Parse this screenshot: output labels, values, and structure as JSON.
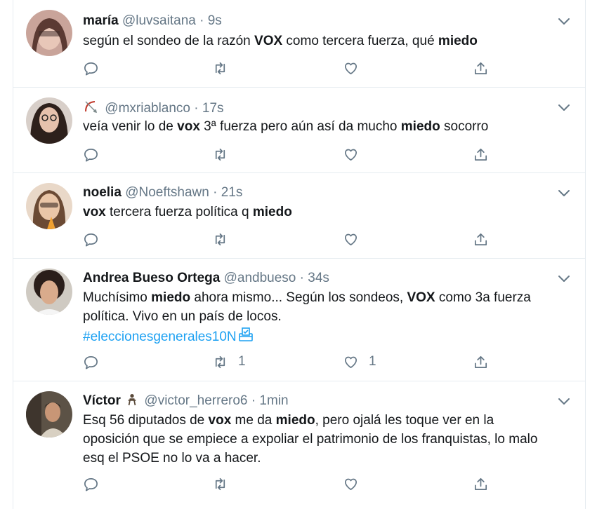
{
  "tweets": [
    {
      "name": "maría",
      "handle": "@luvsaitana",
      "time": "9s",
      "body": [
        "según el sondeo de la razón ",
        {
          "b": "VOX"
        },
        " como tercera fuerza, qué ",
        {
          "b": "miedo"
        }
      ],
      "retweets": "",
      "likes": ""
    },
    {
      "name": "",
      "handle": "@mxriablanco",
      "time": "17s",
      "body": [
        "veía venir lo de ",
        {
          "b": "vox"
        },
        " 3ª fuerza pero aún así da mucho ",
        {
          "b": "miedo"
        },
        " socorro"
      ],
      "retweets": "",
      "likes": ""
    },
    {
      "name": "noelia",
      "handle": "@Noeftshawn",
      "time": "21s",
      "body": [
        {
          "b": "vox"
        },
        " tercera fuerza política q ",
        {
          "b": "miedo"
        }
      ],
      "retweets": "",
      "likes": ""
    },
    {
      "name": "Andrea Bueso Ortega",
      "handle": "@andbueso",
      "time": "34s",
      "body": [
        "Muchísimo ",
        {
          "b": "miedo"
        },
        " ahora mismo... Según los sondeos, ",
        {
          "b": "VOX"
        },
        " como 3a fuerza política. Vivo en un país de locos."
      ],
      "hashtag": "#eleccionesgenerales10N",
      "retweets": "1",
      "likes": "1"
    },
    {
      "name": "Víctor",
      "handle": "@victor_herrero6",
      "time": "1min",
      "body": [
        "Esq 56 diputados de ",
        {
          "b": "vox"
        },
        " me da ",
        {
          "b": "miedo"
        },
        ", pero ojalá les toque ver en la oposición que se empiece a expoliar el patrimonio de los franquistas, lo malo esq el PSOE no lo va a hacer."
      ],
      "retweets": "",
      "likes": ""
    }
  ],
  "icons": {
    "reply": "reply-icon",
    "retweet": "retweet-icon",
    "like": "heart-icon",
    "share": "share-icon",
    "caret": "chevron-down-icon",
    "ballot": "ballot-box-icon",
    "bow": "bow-and-arrow-icon",
    "person": "person-emoji-icon"
  },
  "colors": {
    "text": "#14171a",
    "muted": "#657786",
    "link": "#1da1f2",
    "divider": "#e6ecf0"
  }
}
